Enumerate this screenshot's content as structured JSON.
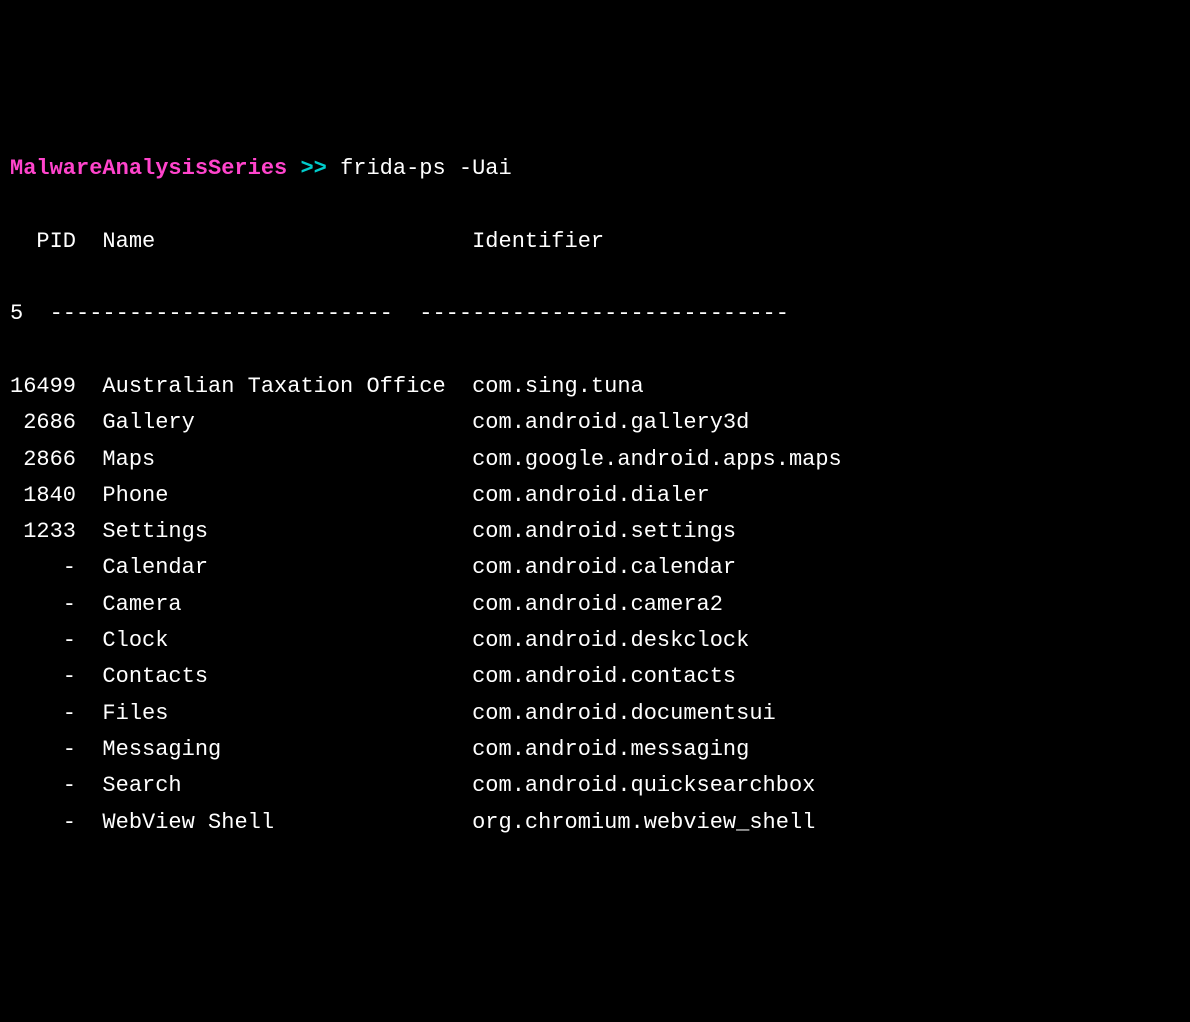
{
  "prompt": {
    "name": "MalwareAnalysisSeries",
    "separator": " >> ",
    "command": "frida-ps -Uai"
  },
  "header": {
    "pid_label": "PID",
    "name_label": "Name",
    "identifier_label": "Identifier"
  },
  "gutter_num": "5",
  "divider": {
    "name_dash": "--------------------------",
    "identifier_dash": "----------------------------"
  },
  "rows": [
    {
      "pid": "16499",
      "name": "Australian Taxation Office",
      "identifier": "com.sing.tuna"
    },
    {
      "pid": " 2686",
      "name": "Gallery",
      "identifier": "com.android.gallery3d"
    },
    {
      "pid": " 2866",
      "name": "Maps",
      "identifier": "com.google.android.apps.maps"
    },
    {
      "pid": " 1840",
      "name": "Phone",
      "identifier": "com.android.dialer"
    },
    {
      "pid": " 1233",
      "name": "Settings",
      "identifier": "com.android.settings"
    },
    {
      "pid": "    -",
      "name": "Calendar",
      "identifier": "com.android.calendar"
    },
    {
      "pid": "    -",
      "name": "Camera",
      "identifier": "com.android.camera2"
    },
    {
      "pid": "    -",
      "name": "Clock",
      "identifier": "com.android.deskclock"
    },
    {
      "pid": "    -",
      "name": "Contacts",
      "identifier": "com.android.contacts"
    },
    {
      "pid": "    -",
      "name": "Files",
      "identifier": "com.android.documentsui"
    },
    {
      "pid": "    -",
      "name": "Messaging",
      "identifier": "com.android.messaging"
    },
    {
      "pid": "    -",
      "name": "Search",
      "identifier": "com.android.quicksearchbox"
    },
    {
      "pid": "    -",
      "name": "WebView Shell",
      "identifier": "org.chromium.webview_shell"
    }
  ]
}
